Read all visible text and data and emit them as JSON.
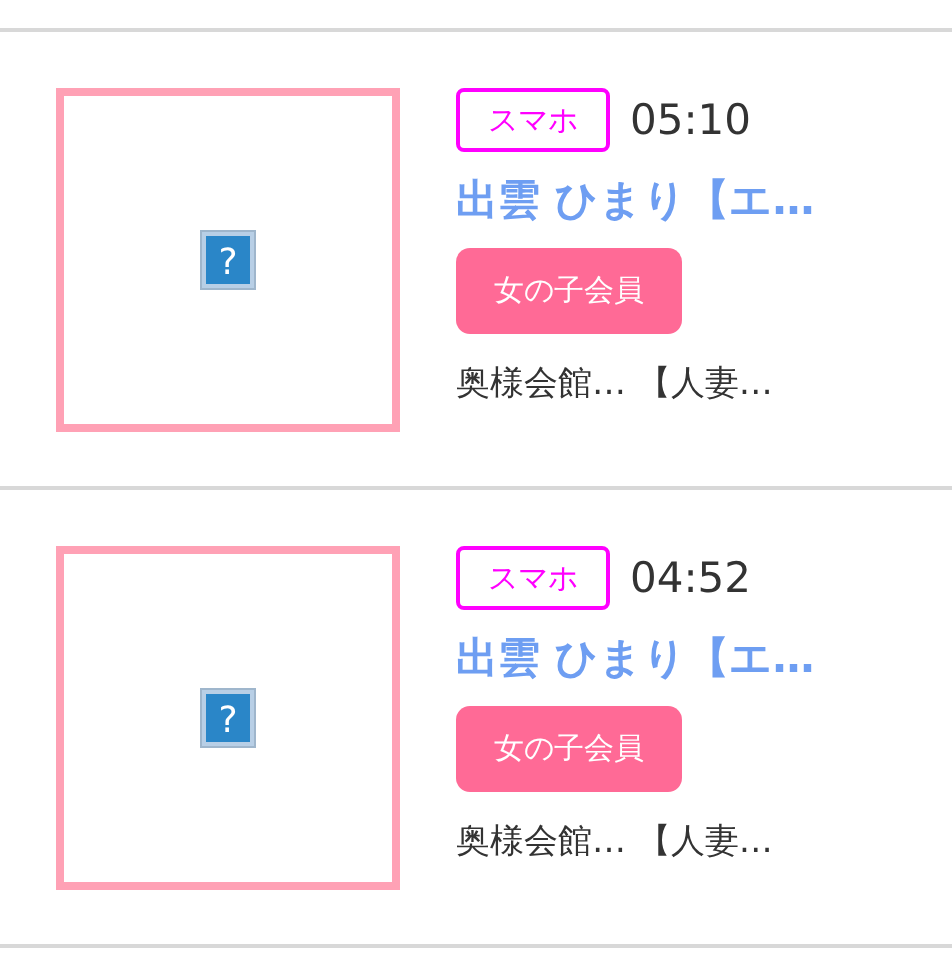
{
  "entries": [
    {
      "device": "スマホ",
      "time": "05:10",
      "name": "出雲 ひまり【エ…",
      "tag": "女の子会員",
      "shop": "奥様会館… 【人妻…",
      "image_icon": "?"
    },
    {
      "device": "スマホ",
      "time": "04:52",
      "name": "出雲 ひまり【エ…",
      "tag": "女の子会員",
      "shop": "奥様会館… 【人妻…",
      "image_icon": "?"
    }
  ]
}
